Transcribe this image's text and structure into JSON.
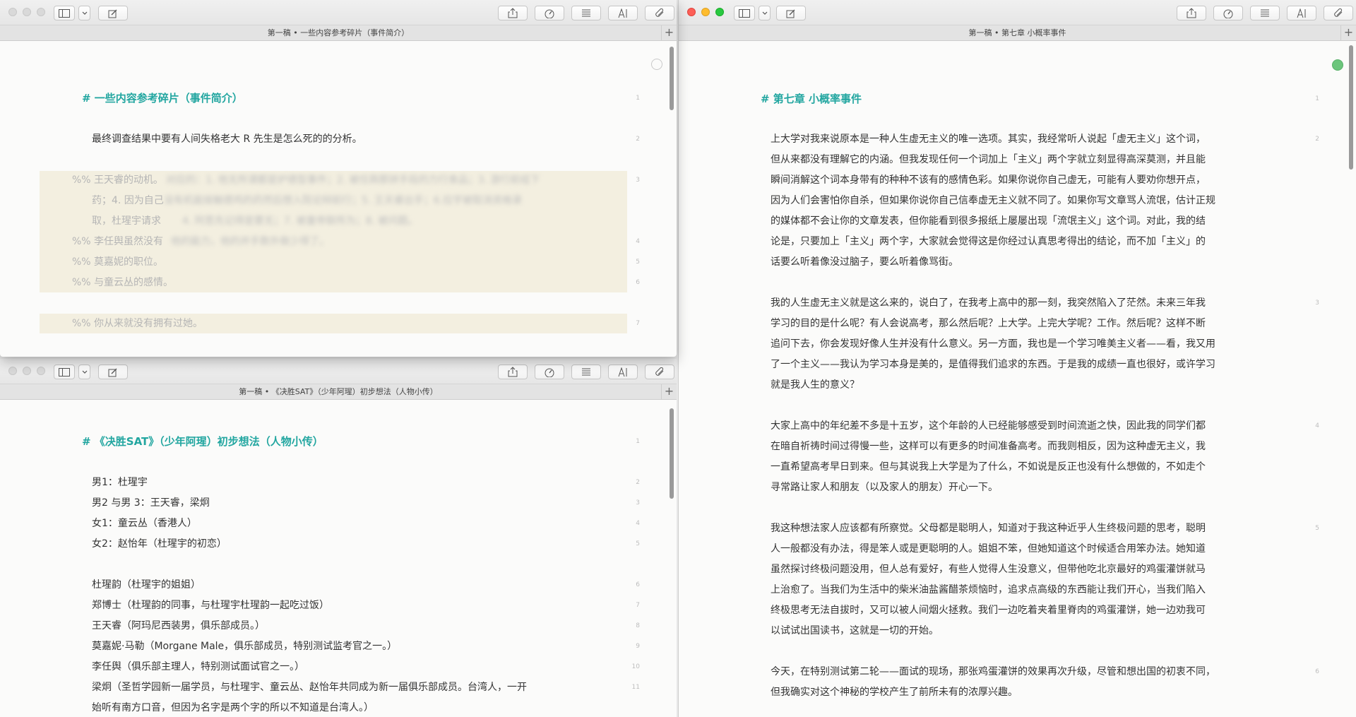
{
  "tl": {
    "tab_title": "第一稿 • 一些内容参考碎片（事件简介）",
    "heading": "# 一些内容参考碎片（事件简介）",
    "lines": [
      "最终调查结果中要有人间失格老大 R 先生是怎么死的的分析。",
      "%% 王天睿的动机。",
      "药；4. 因为自己",
      "取，杜瑆宇请求",
      "%% 李任舆虽然没有",
      "%% 莫嘉妮的职位。",
      "%% 与童云丛的感情。",
      "%% 你从来就没有拥有过她。"
    ],
    "blur_texts": [
      "对应的：1. 他无所谓都是护德型事件；2. 被任舆那拼手段的力行食品；3. 游行前组下",
      "没有机能接触德鸡的药然后想入院论辩前行；5. 王天睿出手；6.拉宇被取消资格录",
      "4. 阿思先记得是要无；7. 被童帝联所为；8. 被问题。",
      "他的能力，他的并手数外做少得了。"
    ],
    "line_numbers": [
      "1",
      "2",
      "3",
      "4",
      "5",
      "6",
      "7"
    ]
  },
  "bl": {
    "tab_title": "第一稿 • 《决胜SAT》（少年阿瑆）初步想法（人物小传）",
    "heading": "# 《决胜SAT》（少年阿瑆）初步想法（人物小传）",
    "lines": [
      "男1：杜瑆宇",
      "男2 与男 3：王天睿，梁炯",
      "女1：童云丛（香港人）",
      "女2：赵怡年（杜瑆宇的初恋）",
      "杜瑆韵（杜瑆宇的姐姐）",
      "郑博士（杜瑆韵的同事，与杜瑆宇杜瑆韵一起吃过饭）",
      "王天睿（阿玛尼西装男，俱乐部成员。）",
      "莫嘉妮·马勒（Morgane Male，俱乐部成员，特别测试监考官之一。）",
      "李任舆（俱乐部主理人，特别测试面试官之一。）",
      "梁炯（圣哲学园新一届学员，与杜瑆宇、童云丛、赵怡年共同成为新一届俱乐部成员。台湾人，一开",
      "始听有南方口音，但因为名字是两个字的所以不知道是台湾人。）"
    ],
    "line_numbers": [
      "1",
      "2",
      "3",
      "4",
      "5",
      "6",
      "7",
      "8",
      "9",
      "10",
      "11"
    ]
  },
  "right": {
    "tab_title": "第一稿 • 第七章 小概率事件",
    "heading": "# 第七章 小概率事件",
    "paragraphs": [
      [
        "上大学对我来说原本是一种人生虚无主义的唯一选项。其实，我经常听人说起「虚无主义」这个词，",
        "但从来都没有理解它的内涵。但我发现任何一个词加上「主义」两个字就立刻显得高深莫测，并且能",
        "瞬间消解这个词本身带有的种种不该有的感情色彩。如果你说你自己虚无，可能有人要劝你想开点，",
        "因为人们会害怕你自杀，但如果你说你自己信奉虚无主义就不同了。如果你写文章骂人流氓，估计正规",
        "的媒体都不会让你的文章发表，但你能看到很多报纸上屡屡出现「流氓主义」这个词。对此，我的结",
        "论是，只要加上「主义」两个字，大家就会觉得这是你经过认真思考得出的结论，而不加「主义」的",
        "话要么听着像没过脑子，要么听着像骂街。"
      ],
      [
        "我的人生虚无主义就是这么来的，说白了，在我考上高中的那一刻，我突然陷入了茫然。未来三年我",
        "学习的目的是什么呢？有人会说高考，那么然后呢？上大学。上完大学呢？工作。然后呢？这样不断",
        "追问下去，你会发现好像人生并没有什么意义。另一方面，我也是一个学习唯美主义者——看，我又用",
        "了一个主义——我认为学习本身是美的，是值得我们追求的东西。于是我的成绩一直也很好，或许学习",
        "就是我人生的意义？"
      ],
      [
        "大家上高中的年纪差不多是十五岁，这个年龄的人已经能够感受到时间流逝之快，因此我的同学们都",
        "在暗自祈祷时间过得慢一些，这样可以有更多的时间准备高考。而我则相反，因为这种虚无主义，我",
        "一直希望高考早日到来。但与其说我上大学是为了什么，不如说是反正也没有什么想做的，不如走个",
        "寻常路让家人和朋友（以及家人的朋友）开心一下。"
      ],
      [
        "我这种想法家人应该都有所察觉。父母都是聪明人，知道对于我这种近乎人生终极问题的思考，聪明",
        "人一般都没有办法，得是笨人或是更聪明的人。姐姐不笨，但她知道这个时候适合用笨办法。她知道",
        "虽然探讨终极问题没用，但人总有爱好，有些人觉得人生没意义，但带他吃北京最好的鸡蛋灌饼就马",
        "上治愈了。当我们为生活中的柴米油盐酱醋茶烦恼时，追求点高级的东西能让我们开心，当我们陷入",
        "终极思考无法自拔时，又可以被人间烟火拯救。我们一边吃着夹着里脊肉的鸡蛋灌饼，她一边劝我可",
        "以试试出国读书，这就是一切的开始。"
      ],
      [
        "今天，在特别测试第二轮——面试的现场，那张鸡蛋灌饼的效果再次升级，尽管和想出国的初衷不同，",
        "但我确实对这个神秘的学校产生了前所未有的浓厚兴趣。"
      ]
    ],
    "line_numbers": [
      "1",
      "2",
      "3",
      "4",
      "5",
      "6"
    ]
  },
  "colors": {
    "heading": "#22a6a0",
    "comment_highlight": "#f3efe0",
    "status_green": "#6cc57c"
  },
  "icons": [
    "sidebar-icon",
    "chevron-down-icon",
    "compose-icon",
    "share-icon",
    "gauge-icon",
    "list-icon",
    "font-icon",
    "paperclip-icon",
    "plus-icon",
    "status-dot-icon"
  ]
}
